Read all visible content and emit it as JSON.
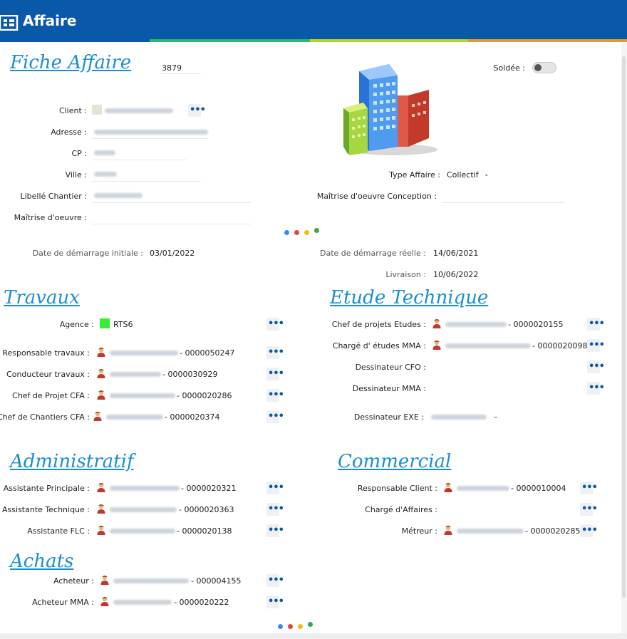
{
  "header": {
    "title": "Affaire",
    "app_icon": "grid-table-icon"
  },
  "colors": {
    "header": "#0a58a8",
    "section": "#1a8fd0",
    "button_dots": "#0a58a8",
    "agence": "#33ee33"
  },
  "fiche": {
    "title": "Fiche Affaire",
    "number": "3879",
    "soldee_label": "Soldée :",
    "client_label": "Client :",
    "adresse_label": "Adresse :",
    "cp_label": "CP :",
    "ville_label": "Ville :",
    "libelle_label": "Libellé Chantier :",
    "maitrise_label": "Maîtrise d'oeuvre :",
    "type_label": "Type Affaire :",
    "type_value": "Collectif",
    "maitrise_conception_label": "Maîtrise d'oeuvre  Conception :",
    "date_initiale_label": "Date de démarrage initiale :",
    "date_initiale_value": "03/01/2022",
    "date_reelle_label": "Date de démarrage réelle :",
    "date_reelle_value": "14/06/2021",
    "livraison_label": "Livraison :",
    "livraison_value": "10/06/2022"
  },
  "travaux": {
    "title": "Travaux",
    "agence_label": "Agence :",
    "agence_value": "RTS6",
    "rows": [
      {
        "label": "Responsable travaux :",
        "code": "- 0000050247"
      },
      {
        "label": "Conducteur travaux :",
        "code": "- 0000030929"
      },
      {
        "label": "Chef de Projet CFA :",
        "code": "- 0000020286"
      },
      {
        "label": "Chef de Chantiers CFA :",
        "code": "- 0000020374"
      }
    ]
  },
  "etude": {
    "title": "Etude Technique",
    "rows": [
      {
        "label": "Chef de projets Etudes :",
        "code": "- 0000020155"
      },
      {
        "label": "Chargé  d' études  MMA :",
        "code": "- 0000020098"
      },
      {
        "label": "Dessinateur CFO :"
      },
      {
        "label": "Dessinateur MMA :"
      },
      {
        "label": "Dessinateur EXE :"
      }
    ]
  },
  "administratif": {
    "title": "Administratif",
    "rows": [
      {
        "label": "Assistante Principale :",
        "code": "- 0000020321"
      },
      {
        "label": "Assistante Technique :",
        "code": "- 0000020363"
      },
      {
        "label": "Assistante FLC :",
        "code": "- 0000020138"
      }
    ]
  },
  "commercial": {
    "title": "Commercial",
    "rows": [
      {
        "label": "Responsable Client :",
        "code": "- 0000010004"
      },
      {
        "label": "Chargé d'Affaires :"
      },
      {
        "label": "Métreur :",
        "code": "- 0000020285"
      }
    ]
  },
  "achats": {
    "title": "Achats",
    "rows": [
      {
        "label": "Acheteur :",
        "code": "- 000004155"
      },
      {
        "label": "Acheteur MMA :",
        "code": "- 0000020222"
      }
    ]
  },
  "buttons": {
    "dots": "•••"
  },
  "icons": {
    "person": "person-icon",
    "building": "building-icon",
    "chevron": "chevron-down-icon"
  }
}
